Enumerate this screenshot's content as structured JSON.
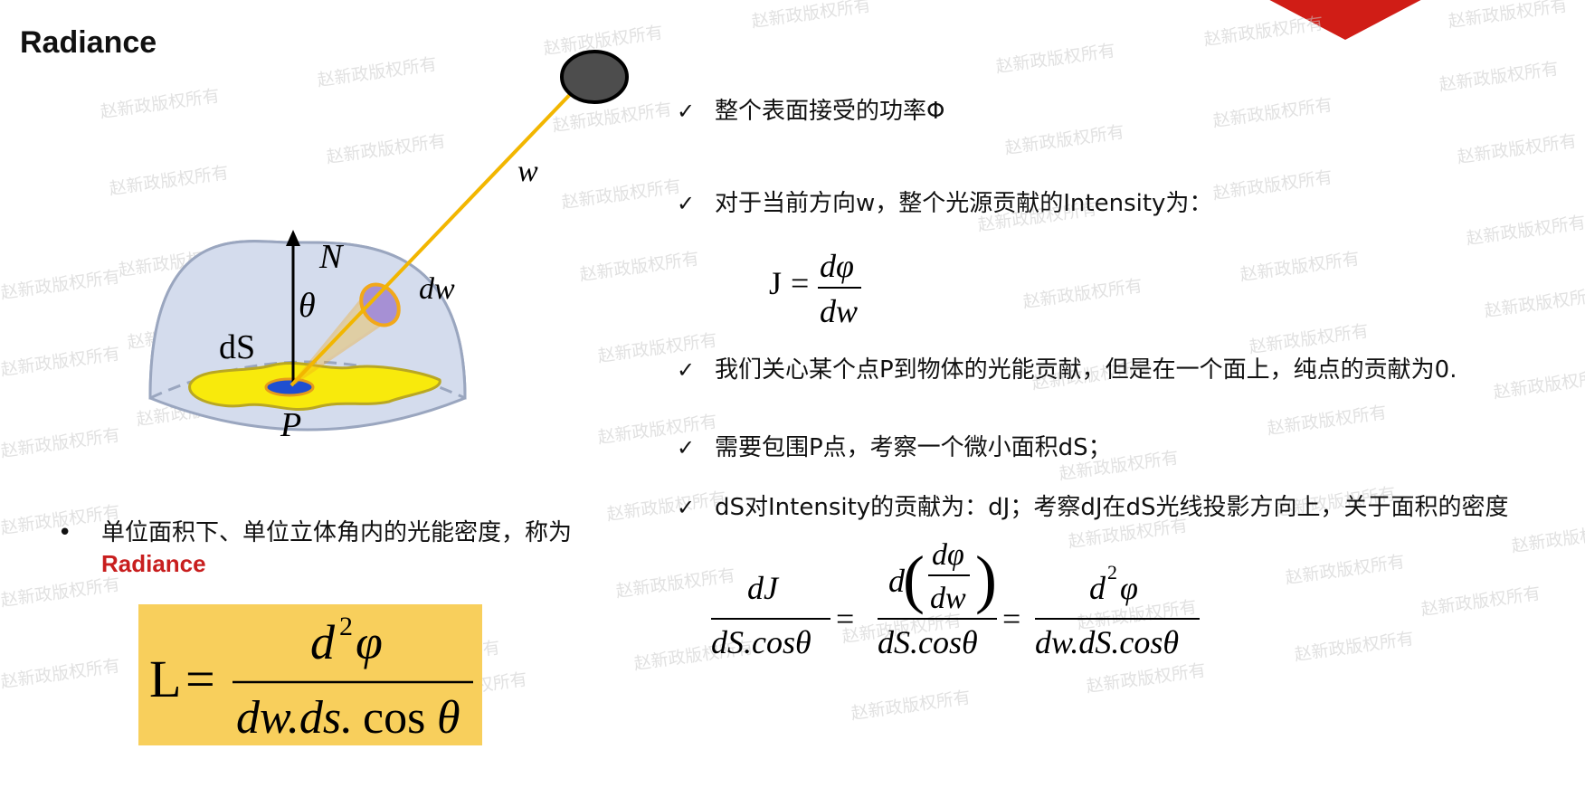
{
  "slide": {
    "title": "Radiance",
    "watermark": "赵新政版权所有"
  },
  "diagram": {
    "label_w": "w",
    "label_N": "N",
    "label_theta": "θ",
    "label_dw": "dw",
    "label_dS": "dS",
    "label_P": "P"
  },
  "left": {
    "bullet": "•",
    "bullet_text": "单位面积下、单位立体角内的光能密度，称为",
    "bullet_highlight": "Radiance",
    "formula_L": {
      "lhs": "L",
      "eq": "=",
      "num_d": "d",
      "num_sup": "2",
      "num_phi": "φ",
      "den": "dw.ds.",
      "den_cos": "cos",
      "den_theta": "θ"
    }
  },
  "right": {
    "check": "✓",
    "items": [
      "整个表面接受的功率Φ",
      "对于当前方向w，整个光源贡献的Intensity为：",
      "我们关心某个点P到物体的光能贡献，但是在一个面上，纯点的贡献为0.",
      "需要包围P点，考察一个微小面积dS；",
      "dS对Intensity的贡献为：dJ；考察dJ在dS光线投影方向上，关于面积的密度"
    ],
    "formula_J": {
      "lhs": "J",
      "eq": "=",
      "num": "dφ",
      "den": "dw"
    },
    "formula_dJ": {
      "f1_num": "dJ",
      "f1_den": "dS.cosθ",
      "eq": "=",
      "f2_outer_d": "d",
      "f2_inner_num": "dφ",
      "f2_inner_den": "dw",
      "f2_den": "dS.cosθ",
      "f3_num_d": "d",
      "f3_num_sup": "2",
      "f3_num_phi": "φ",
      "f3_den": "dw.dS.cosθ"
    }
  }
}
